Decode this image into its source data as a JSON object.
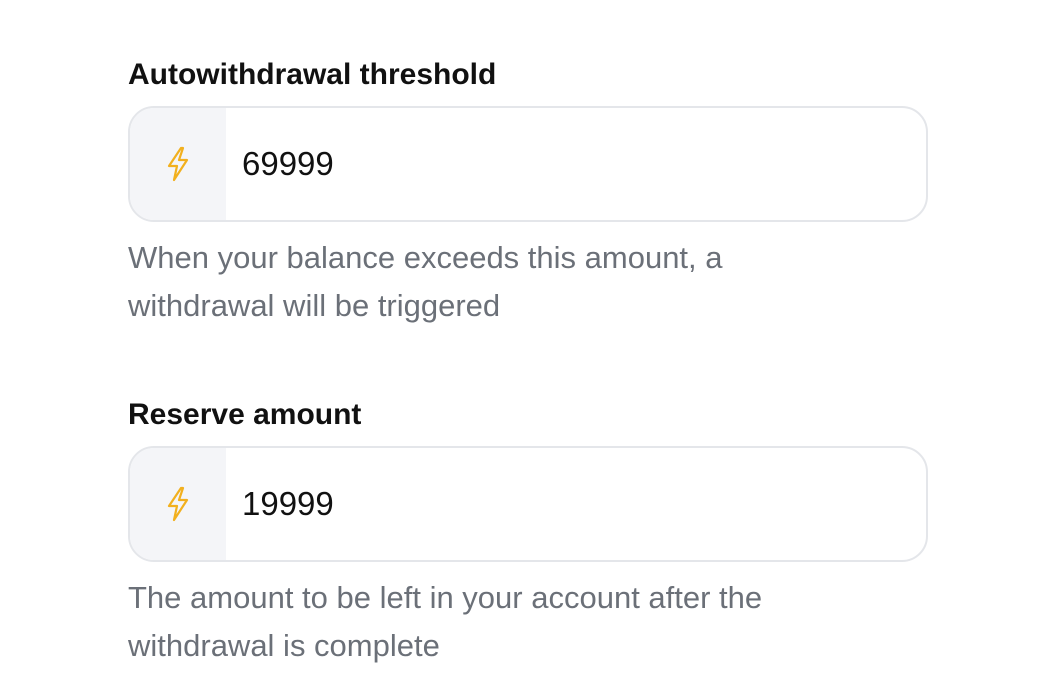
{
  "colors": {
    "label": "#111111",
    "help_text": "#6b7078",
    "border": "#e4e6ea",
    "addon_bg": "#f4f5f8",
    "bolt": "#f2b01e"
  },
  "threshold": {
    "label": "Autowithdrawal threshold",
    "icon": "lightning-bolt-icon",
    "value": "69999",
    "help": "When your balance exceeds this amount, a withdrawal will be triggered"
  },
  "reserve": {
    "label": "Reserve amount",
    "icon": "lightning-bolt-icon",
    "value": "19999",
    "help": "The amount to be left in your account after the withdrawal is complete"
  }
}
